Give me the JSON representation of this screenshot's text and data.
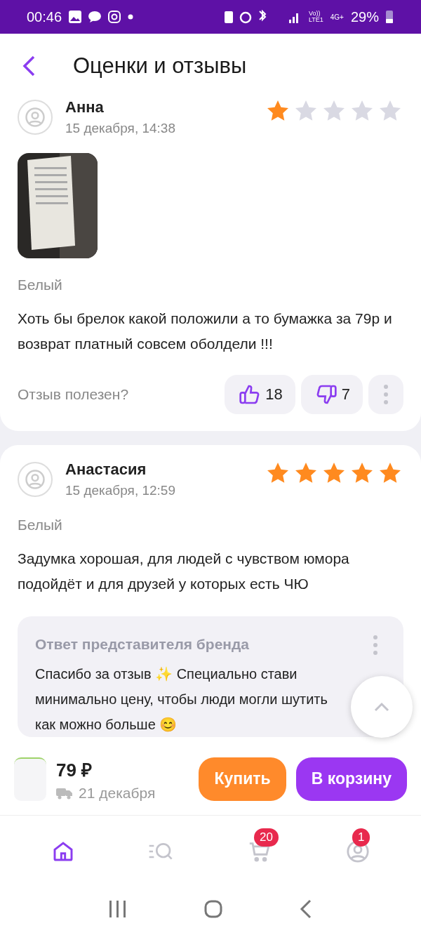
{
  "status_bar": {
    "time": "00:46",
    "net1": "Vo))\nLTE1",
    "net2": "4G+",
    "battery": "29%"
  },
  "header": {
    "title": "Оценки и отзывы"
  },
  "reviews": [
    {
      "author": "Анна",
      "date": "15 декабря, 14:38",
      "stars": 1,
      "photos": [
        {
          "kind": "picture"
        }
      ],
      "variant": "Белый",
      "text": "Хоть бы брелок какой положили а то бумажка за 79р и возврат платный совсем оболдели !!!",
      "helpful_label": "Отзыв полезен?",
      "likes": "18",
      "dislikes": "7"
    },
    {
      "author": "Анастасия",
      "date": "15 декабря, 12:59",
      "stars": 5,
      "variant": "Белый",
      "text": "Задумка хорошая, для людей с чувством юмора подойдёт и для друзей у которых есть ЧЮ",
      "reply": {
        "title": "Ответ представителя бренда",
        "text": "Спасибо за отзыв ✨ Специально стави минимально  цену, чтобы люди могли шутить как можно больше 😊"
      }
    }
  ],
  "purchase_bar": {
    "price": "79 ₽",
    "delivery": "21 декабря",
    "buy": "Купить",
    "cart": "В корзину"
  },
  "bottom_nav": [
    {
      "kind": "home",
      "selected": true
    },
    {
      "kind": "catalog",
      "selected": false
    },
    {
      "kind": "cart",
      "selected": false,
      "badge": "20"
    },
    {
      "kind": "profile",
      "selected": false,
      "badge": "1"
    }
  ]
}
